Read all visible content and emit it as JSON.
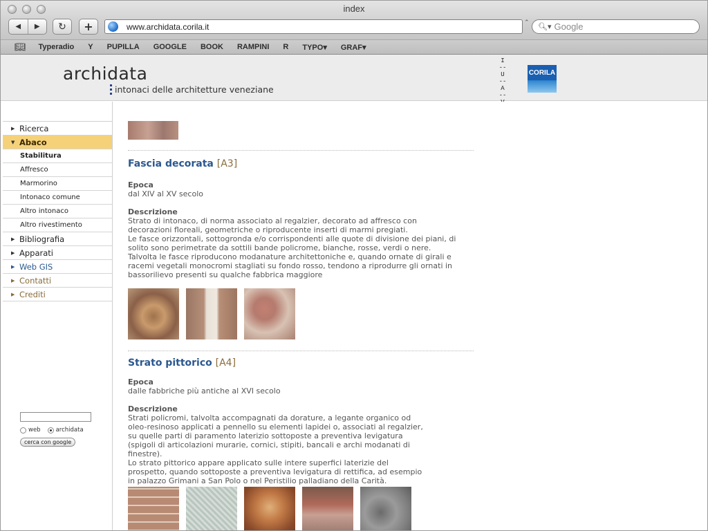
{
  "browser": {
    "window_title": "index",
    "url": "www.archidata.corila.it",
    "search_placeholder": "Google",
    "bookmarks": [
      "Typeradio",
      "Y",
      "PUPILLA",
      "GOOGLE",
      "BOOK",
      "RAMPINI",
      "R",
      "TYPO▾",
      "GRAF▾"
    ]
  },
  "site": {
    "logo": "archidata",
    "tagline": "intonaci delle architetture veneziane",
    "iuav_letters": [
      "I",
      "U",
      "A",
      "V"
    ],
    "partner_logo": "CORILA"
  },
  "sidebar": {
    "items": [
      {
        "label": "Ricerca"
      },
      {
        "label": "Abaco"
      },
      {
        "label": "Stabilitura"
      },
      {
        "label": "Affresco"
      },
      {
        "label": "Marmorino"
      },
      {
        "label": "Intonaco comune"
      },
      {
        "label": "Altro intonaco"
      },
      {
        "label": "Altro rivestimento"
      },
      {
        "label": "Bibliografia"
      },
      {
        "label": "Apparati"
      },
      {
        "label": "Web GIS"
      },
      {
        "label": "Contatti"
      },
      {
        "label": "Crediti"
      }
    ],
    "search": {
      "radio_web": "web",
      "radio_site": "archidata",
      "button": "cerca con google"
    }
  },
  "entries": [
    {
      "title": "Fascia decorata",
      "code": "[A3]",
      "epoca_label": "Epoca",
      "epoca": "dal XIV al XV secolo",
      "descr_label": "Descrizione",
      "descr": "Strato di intonaco, di norma associato al regalzier, decorato ad affresco con decorazioni floreali, geometriche o riproducente inserti di marmi pregiati.\nLe fasce orizzontali, sottogronda e/o corrispondenti alle quote di divisione dei piani, di solito sono perimetrate da sottili bande policrome, bianche, rosse, verdi o nere.\nTalvolta le fasce riproducono modanature architettoniche e, quando ornate di girali e racemi vegetali monocromi stagliati su fondo rosso, tendono a riprodurre gli ornati in bassorilievo presenti su qualche fabbrica maggiore"
    },
    {
      "title": "Strato pittorico",
      "code": "[A4]",
      "epoca_label": "Epoca",
      "epoca": "dalle fabbriche più antiche al XVI secolo",
      "descr_label": "Descrizione",
      "descr": "Strati policromi, talvolta accompagnati da dorature, a legante organico od oleo-resinoso applicati a pennello su elementi lapidei o, associati al regalzier, su quelle parti di paramento laterizio sottoposte a preventiva levigatura (spigoli di articolazioni murarie, cornici, stipiti, bancali e archi modanati di finestre).\nLo strato pittorico appare applicato sulle intere superfici laterizie del prospetto, quando sottoposte a preventiva levigatura di rettifica, ad esempio in palazzo Grimani a San Polo o nel Peristilio palladiano della Carità."
    }
  ]
}
